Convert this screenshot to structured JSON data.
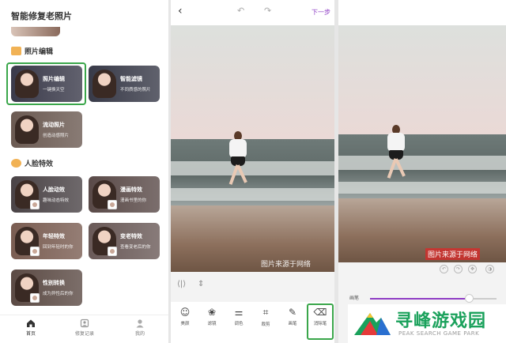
{
  "home": {
    "title": "智能修复老照片",
    "sections": [
      {
        "heading": "照片编辑"
      },
      {
        "heading": "人脸特效"
      }
    ],
    "cards": [
      {
        "title": "照片编辑",
        "subtitle": "一键换天空",
        "bg": "#3a3a4a"
      },
      {
        "title": "智能滤镜",
        "subtitle": "不同质感的照片",
        "bg": "#383a48"
      },
      {
        "title": "流动照片",
        "subtitle": "创造动感照片",
        "bg": "#6b5a52"
      },
      {
        "title": "人脸动效",
        "subtitle": "趣味动态特效",
        "bg": "#4a4346"
      },
      {
        "title": "漫画特效",
        "subtitle": "漫画书里的你",
        "bg": "#5a4a48"
      },
      {
        "title": "年轻特效",
        "subtitle": "回到年轻时的你",
        "bg": "#7a5d52"
      },
      {
        "title": "变老特效",
        "subtitle": "查看变老后的你",
        "bg": "#6a5a58"
      },
      {
        "title": "性别转换",
        "subtitle": "成为异性后的你",
        "bg": "#5b4a44"
      }
    ],
    "tabs": [
      {
        "label": "首页"
      },
      {
        "label": "修复记录"
      },
      {
        "label": "我的"
      }
    ]
  },
  "editor": {
    "next_label": "下一步",
    "watermark": "图片来源于网络",
    "tools": [
      {
        "label": "美颜",
        "icon": "face-icon"
      },
      {
        "label": "滤镜",
        "icon": "filter-icon"
      },
      {
        "label": "调色",
        "icon": "adjust-icon"
      },
      {
        "label": "裁剪",
        "icon": "crop-icon"
      },
      {
        "label": "画笔",
        "icon": "brush-icon"
      },
      {
        "label": "消除笔",
        "icon": "eraser-icon"
      }
    ]
  },
  "result": {
    "watermark": "图片来源于网络",
    "brush_label": "画笔",
    "brush_level": 0.78
  },
  "logo": {
    "name": "寻峰游戏园",
    "subtitle": "PEAK SEARCH GAME PARK"
  },
  "colors": {
    "accent": "#8e3cc4",
    "highlight": "#3aa64a",
    "logo_green": "#1aa15b"
  }
}
